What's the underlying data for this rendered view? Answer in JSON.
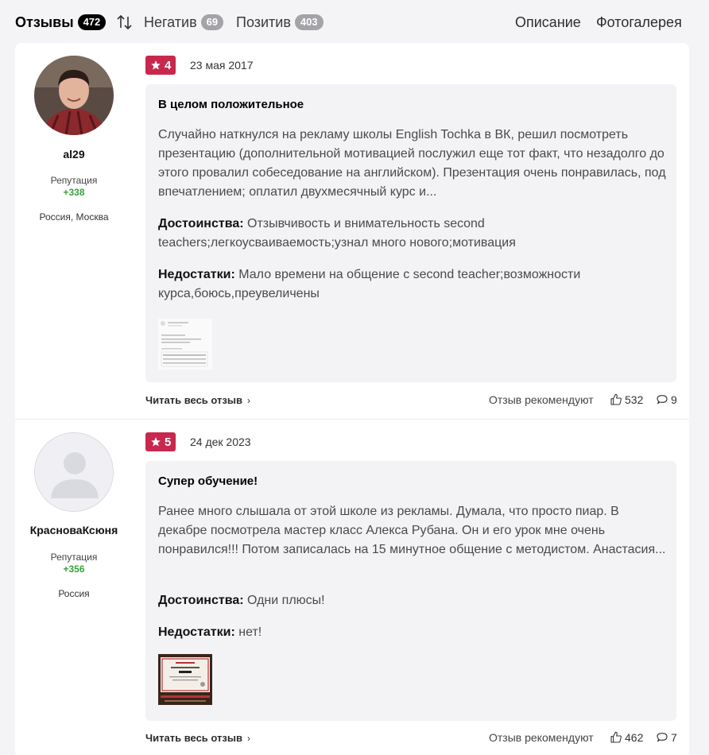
{
  "tabs": {
    "reviews": {
      "label": "Отзывы",
      "count": "472"
    },
    "negative": {
      "label": "Негатив",
      "count": "69"
    },
    "positive": {
      "label": "Позитив",
      "count": "403"
    },
    "sort_icon": "sort-arrows-icon",
    "description": "Описание",
    "gallery": "Фотогалерея"
  },
  "reviews": [
    {
      "user": {
        "name": "al29",
        "reputation_label": "Репутация",
        "reputation": "+338",
        "location": "Россия, Москва",
        "avatar": "photo"
      },
      "rating": "4",
      "date": "23 мая 2017",
      "title": "В целом положительное",
      "text": "Случайно наткнулся на рекламу школы English Tochka в ВК, решил посмотреть презентацию (дополнительной мотивацией послужил еще тот факт, что незадолго до этого провалил собеседование на английском). Презентация очень понравилась, под впечатлением; оплатил двухмесячный курс и...",
      "pros_label": "Достоинства:",
      "pros": "Отзывчивость и внимательность second teachers;легкоусваиваемость;узнал много нового;мотивация",
      "cons_label": "Недостатки:",
      "cons": "Мало времени на общение с second teacher;возможности курса,боюсь,преувеличены",
      "read_all": "Читать весь отзыв",
      "recommend_label": "Отзыв рекомендуют",
      "likes": "532",
      "comments": "9"
    },
    {
      "user": {
        "name": "КрасноваКсюня",
        "reputation_label": "Репутация",
        "reputation": "+356",
        "location": "Россия",
        "avatar": "placeholder"
      },
      "rating": "5",
      "date": "24 дек 2023",
      "title": "Супер обучение!",
      "text": "Ранее много слышала от этой школе из рекламы. Думала, что просто пиар. В декабре посмотрела мастер класс Алекса Рубана. Он и его урок мне очень понравился!!! Потом записалась на 15 минутное общение с методистом. Анастасия...",
      "pros_label": "Достоинства:",
      "pros": "Одни плюсы!",
      "cons_label": "Недостатки:",
      "cons": "нет!",
      "read_all": "Читать весь отзыв",
      "recommend_label": "Отзыв рекомендуют",
      "likes": "462",
      "comments": "7"
    }
  ],
  "colors": {
    "rating_badge": "#c8284d",
    "reputation": "#36a33b",
    "active_badge": "#000000",
    "inactive_badge": "#a3a3a8"
  }
}
